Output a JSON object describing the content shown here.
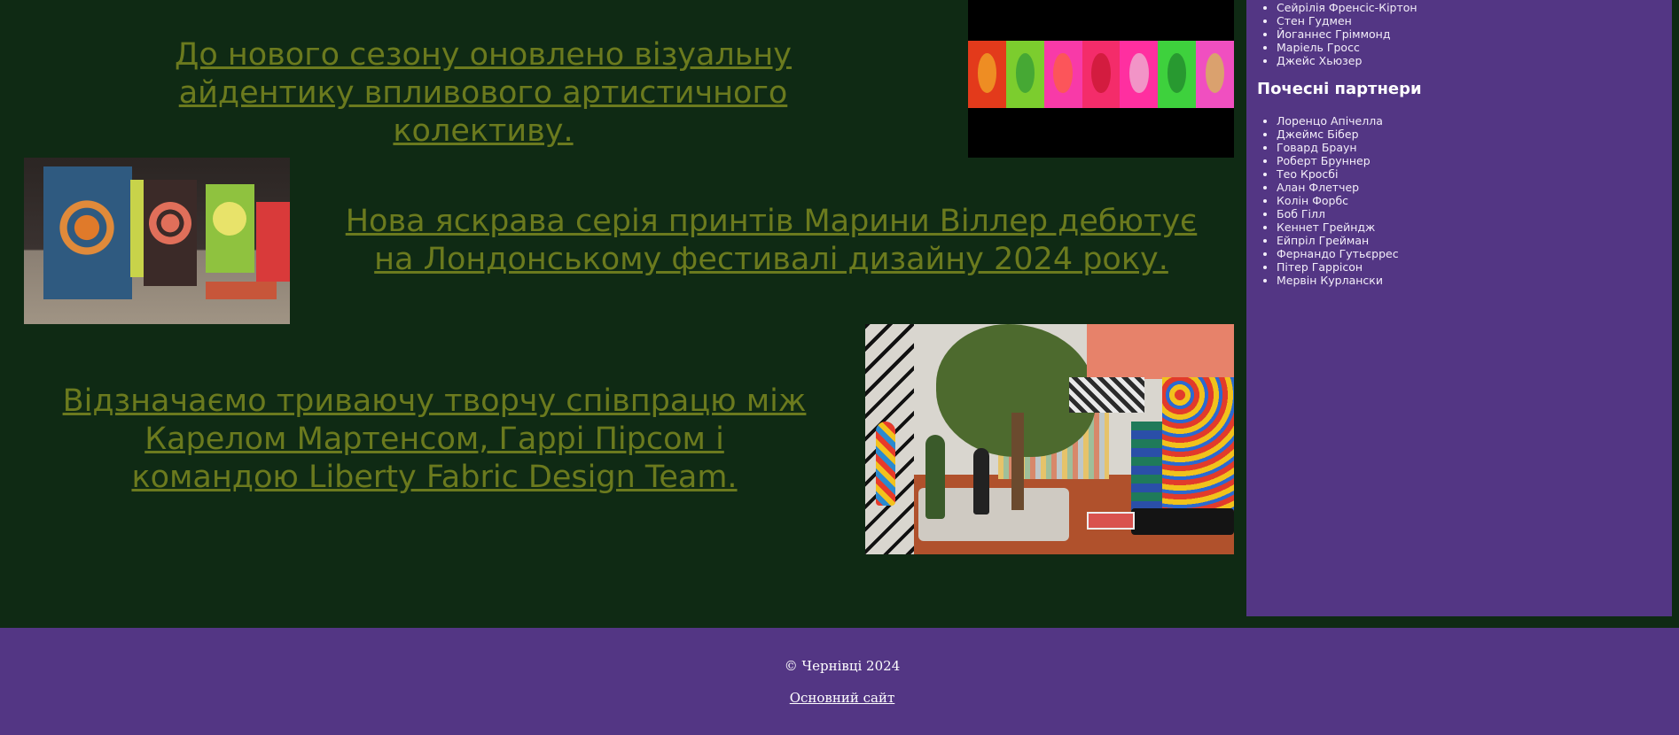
{
  "news": [
    {
      "text": "До нового сезону оновлено візуальну айдентику впливового артистичного колективу."
    },
    {
      "text": "Нова яскрава серія принтів Марини Віллер дебютує на Лондонському фестивалі дизайну 2024 року."
    },
    {
      "text": "Відзначаємо триваючу творчу співпрацю між Карелом Мартенсом, Гаррі Пірсом і командою Liberty Fabric Design Team."
    }
  ],
  "sidebar": {
    "top_list": [
      "Сейрілія Френсіс-Кіртон",
      "Стен Гудмен",
      "Йоганнес Гріммонд",
      "Маріель Гросс",
      "Джейс Хьюзер"
    ],
    "partners_heading": "Почесні партнери",
    "partners": [
      "Лоренцо Апічелла",
      "Джеймс Бібер",
      "Говард Браун",
      "Роберт Бруннер",
      "Тео Кросбі",
      "Алан Флетчер",
      "Колін Форбс",
      "Боб Гілл",
      "Кеннет Грейндж",
      "Ейпріл Грейман",
      "Фернандо Гутьєррес",
      "Пітер Гаррісон",
      "Мервін Курлански"
    ]
  },
  "footer": {
    "copyright": "© Чернівці 2024",
    "main_site_link": "Основний сайт"
  },
  "colors": {
    "background": "#0f2a14",
    "link_olive": "#6b7a1e",
    "purple": "#533684"
  }
}
